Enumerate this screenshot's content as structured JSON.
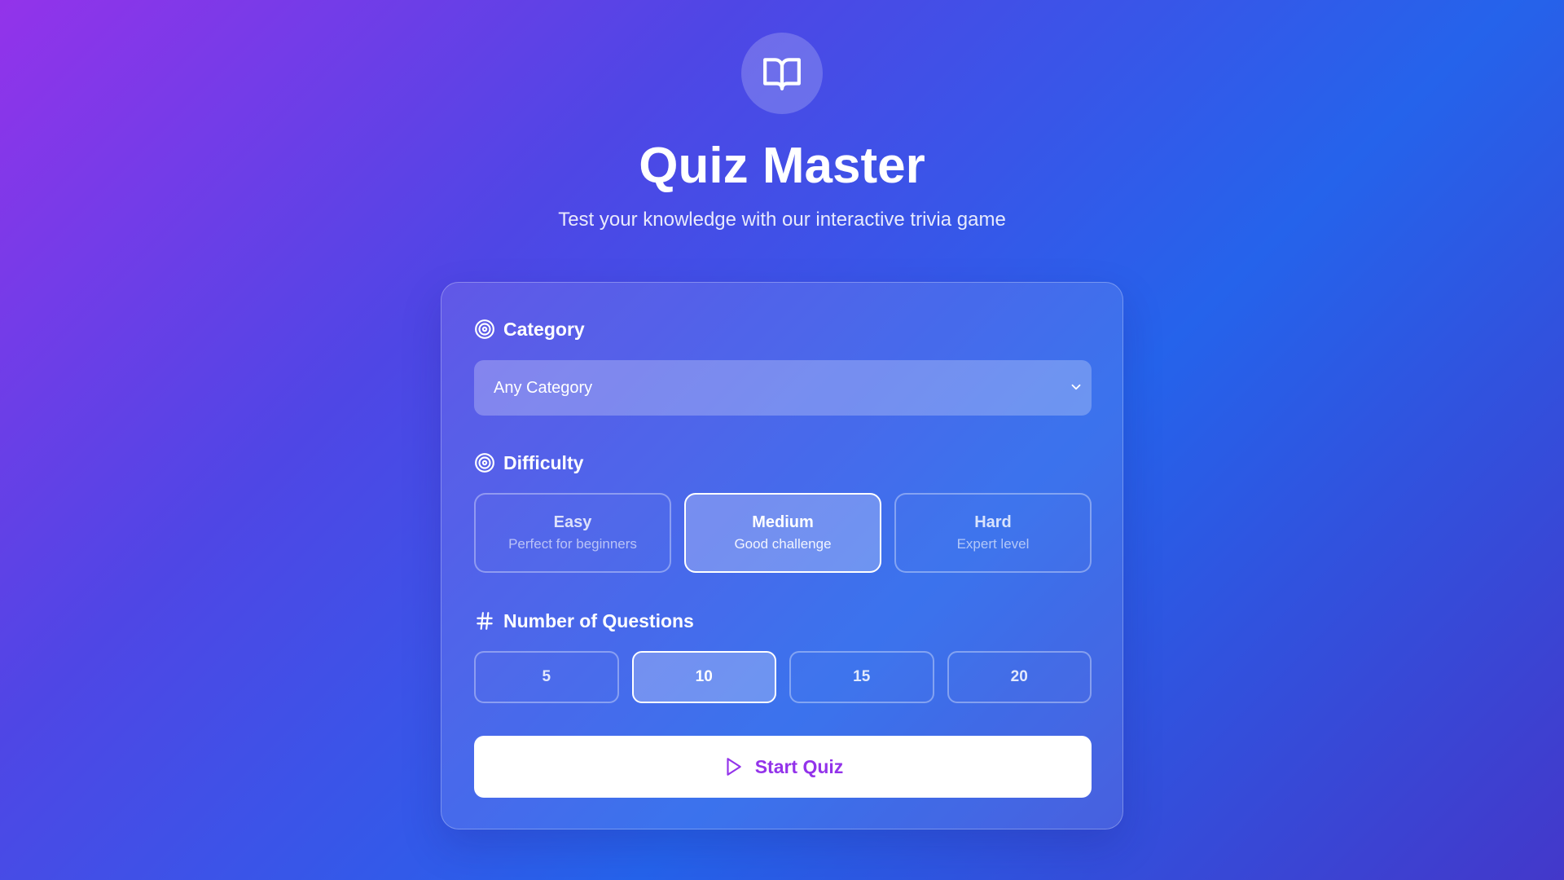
{
  "header": {
    "icon": "open-book-icon",
    "title": "Quiz Master",
    "subtitle": "Test your knowledge with our interactive trivia game"
  },
  "category": {
    "label": "Category",
    "icon": "target-icon",
    "selected": "Any Category"
  },
  "difficulty": {
    "label": "Difficulty",
    "icon": "target-icon",
    "options": [
      {
        "name": "Easy",
        "description": "Perfect for beginners"
      },
      {
        "name": "Medium",
        "description": "Good challenge"
      },
      {
        "name": "Hard",
        "description": "Expert level"
      }
    ],
    "selected": "Medium"
  },
  "questions": {
    "label": "Number of Questions",
    "icon": "hash-icon",
    "options": [
      "5",
      "10",
      "15",
      "20"
    ],
    "selected": "10"
  },
  "start": {
    "label": "Start Quiz",
    "icon": "play-icon"
  },
  "colors": {
    "accent": "#9333ea",
    "gradient_start": "#9333ea",
    "gradient_mid": "#2563eb",
    "gradient_end": "#4338ca"
  }
}
